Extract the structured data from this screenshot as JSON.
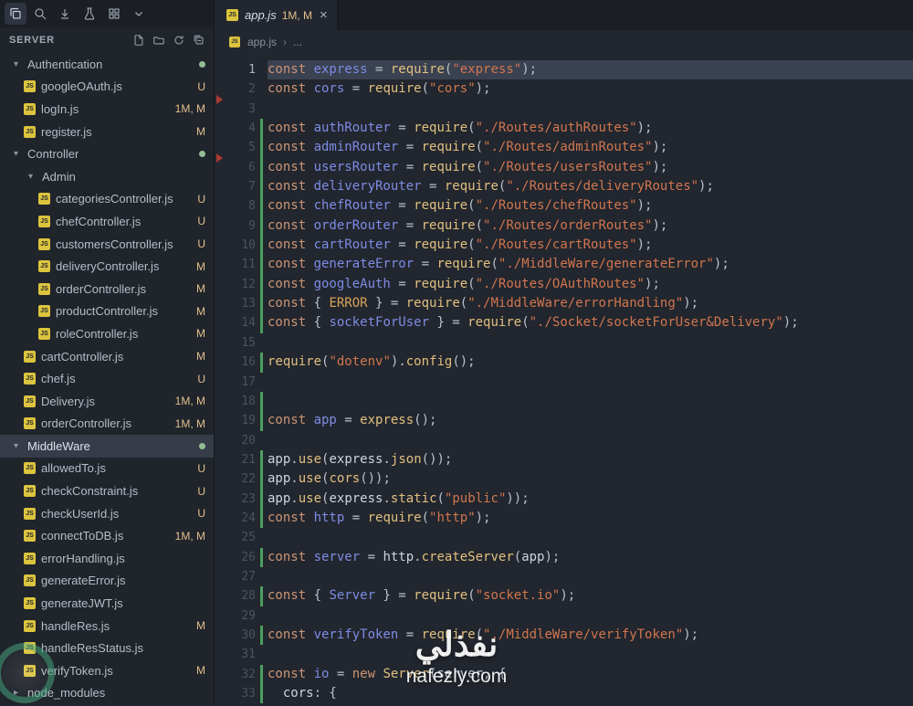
{
  "icons": {
    "js_label": "JS",
    "chevron_expanded": "▾",
    "chevron_collapsed": "▸",
    "breadcrumb_sep": "›",
    "more": "...",
    "close": "×"
  },
  "colors": {
    "editor_bg": "#22262e",
    "sidebar_bg": "#20242b",
    "topbar_bg": "#1b1e24",
    "selection_row": "#363d49",
    "line_highlight": "#3a4150",
    "git_add": "#4c9e5f",
    "git_delete": "#a83a31",
    "badge_modified": "#e2c08d",
    "folder_dot": "#93bd93",
    "js_icon": "#dcc43e"
  },
  "activity_bar": {
    "icons": [
      "copy-pages-icon",
      "search-icon",
      "download-icon",
      "beaker-icon",
      "grid-icon",
      "chevron-down-icon"
    ]
  },
  "sidebar": {
    "title": "SERVER",
    "actions": [
      "new-file-icon",
      "new-folder-icon",
      "refresh-icon",
      "collapse-all-icon"
    ],
    "tree": [
      {
        "type": "folder",
        "label": "Authentication",
        "depth": 0,
        "expanded": true,
        "dot": true
      },
      {
        "type": "file",
        "label": "googleOAuth.js",
        "depth": 1,
        "badge": "U"
      },
      {
        "type": "file",
        "label": "logIn.js",
        "depth": 1,
        "badge": "1M, M"
      },
      {
        "type": "file",
        "label": "register.js",
        "depth": 1,
        "badge": "M"
      },
      {
        "type": "folder",
        "label": "Controller",
        "depth": 0,
        "expanded": true,
        "dot": true
      },
      {
        "type": "folder",
        "label": "Admin",
        "depth": 1,
        "expanded": true
      },
      {
        "type": "file",
        "label": "categoriesController.js",
        "depth": 2,
        "badge": "U"
      },
      {
        "type": "file",
        "label": "chefController.js",
        "depth": 2,
        "badge": "U"
      },
      {
        "type": "file",
        "label": "customersController.js",
        "depth": 2,
        "badge": "U"
      },
      {
        "type": "file",
        "label": "deliveryController.js",
        "depth": 2,
        "badge": "M"
      },
      {
        "type": "file",
        "label": "orderController.js",
        "depth": 2,
        "badge": "M"
      },
      {
        "type": "file",
        "label": "productController.js",
        "depth": 2,
        "badge": "M"
      },
      {
        "type": "file",
        "label": "roleController.js",
        "depth": 2,
        "badge": "M"
      },
      {
        "type": "file",
        "label": "cartController.js",
        "depth": 1,
        "badge": "M"
      },
      {
        "type": "file",
        "label": "chef.js",
        "depth": 1,
        "badge": "U"
      },
      {
        "type": "file",
        "label": "Delivery.js",
        "depth": 1,
        "badge": "1M, M"
      },
      {
        "type": "file",
        "label": "orderController.js",
        "depth": 1,
        "badge": "1M, M"
      },
      {
        "type": "folder",
        "label": "MiddleWare",
        "depth": 0,
        "expanded": true,
        "dot": true,
        "selected": true
      },
      {
        "type": "file",
        "label": "allowedTo.js",
        "depth": 1,
        "badge": "U"
      },
      {
        "type": "file",
        "label": "checkConstraint.js",
        "depth": 1,
        "badge": "U"
      },
      {
        "type": "file",
        "label": "checkUserId.js",
        "depth": 1,
        "badge": "U"
      },
      {
        "type": "file",
        "label": "connectToDB.js",
        "depth": 1,
        "badge": "1M, M"
      },
      {
        "type": "file",
        "label": "errorHandling.js",
        "depth": 1
      },
      {
        "type": "file",
        "label": "generateError.js",
        "depth": 1
      },
      {
        "type": "file",
        "label": "generateJWT.js",
        "depth": 1
      },
      {
        "type": "file",
        "label": "handleRes.js",
        "depth": 1,
        "badge": "M"
      },
      {
        "type": "file",
        "label": "handleResStatus.js",
        "depth": 1
      },
      {
        "type": "file",
        "label": "verifyToken.js",
        "depth": 1,
        "badge": "M"
      },
      {
        "type": "folder",
        "label": "node_modules",
        "depth": 0,
        "expanded": false
      }
    ]
  },
  "editor": {
    "tab": {
      "label": "app.js",
      "status": "1M, M"
    },
    "breadcrumb": {
      "file": "app.js"
    },
    "code": {
      "lines": [
        {
          "n": 1,
          "hl": true,
          "tokens": [
            [
              "k",
              "const "
            ],
            [
              "i",
              "express "
            ],
            [
              "p",
              "= "
            ],
            [
              "f",
              "require"
            ],
            [
              "p",
              "("
            ],
            [
              "s",
              "\"express\""
            ],
            [
              "p",
              ");"
            ]
          ]
        },
        {
          "n": 2,
          "tokens": [
            [
              "k",
              "const "
            ],
            [
              "i",
              "cors "
            ],
            [
              "p",
              "= "
            ],
            [
              "f",
              "require"
            ],
            [
              "p",
              "("
            ],
            [
              "s",
              "\"cors\""
            ],
            [
              "p",
              ");"
            ]
          ]
        },
        {
          "n": 3,
          "del": true,
          "tokens": []
        },
        {
          "n": 4,
          "git": "add",
          "tokens": [
            [
              "k",
              "const "
            ],
            [
              "i",
              "authRouter "
            ],
            [
              "p",
              "= "
            ],
            [
              "f",
              "require"
            ],
            [
              "p",
              "("
            ],
            [
              "s",
              "\"./Routes/authRoutes\""
            ],
            [
              "p",
              ");"
            ]
          ]
        },
        {
          "n": 5,
          "git": "add",
          "tokens": [
            [
              "k",
              "const "
            ],
            [
              "i",
              "adminRouter "
            ],
            [
              "p",
              "= "
            ],
            [
              "f",
              "require"
            ],
            [
              "p",
              "("
            ],
            [
              "s",
              "\"./Routes/adminRoutes\""
            ],
            [
              "p",
              ");"
            ]
          ]
        },
        {
          "n": 6,
          "git": "add",
          "del": true,
          "tokens": [
            [
              "k",
              "const "
            ],
            [
              "i",
              "usersRouter "
            ],
            [
              "p",
              "= "
            ],
            [
              "f",
              "require"
            ],
            [
              "p",
              "("
            ],
            [
              "s",
              "\"./Routes/usersRoutes\""
            ],
            [
              "p",
              ");"
            ]
          ]
        },
        {
          "n": 7,
          "git": "add",
          "tokens": [
            [
              "k",
              "const "
            ],
            [
              "i",
              "deliveryRouter "
            ],
            [
              "p",
              "= "
            ],
            [
              "f",
              "require"
            ],
            [
              "p",
              "("
            ],
            [
              "s",
              "\"./Routes/deliveryRoutes\""
            ],
            [
              "p",
              ");"
            ]
          ]
        },
        {
          "n": 8,
          "git": "add",
          "tokens": [
            [
              "k",
              "const "
            ],
            [
              "i",
              "chefRouter "
            ],
            [
              "p",
              "= "
            ],
            [
              "f",
              "require"
            ],
            [
              "p",
              "("
            ],
            [
              "s",
              "\"./Routes/chefRoutes\""
            ],
            [
              "p",
              ");"
            ]
          ]
        },
        {
          "n": 9,
          "git": "add",
          "tokens": [
            [
              "k",
              "const "
            ],
            [
              "i",
              "orderRouter "
            ],
            [
              "p",
              "= "
            ],
            [
              "f",
              "require"
            ],
            [
              "p",
              "("
            ],
            [
              "s",
              "\"./Routes/orderRoutes\""
            ],
            [
              "p",
              ");"
            ]
          ]
        },
        {
          "n": 10,
          "git": "add",
          "tokens": [
            [
              "k",
              "const "
            ],
            [
              "i",
              "cartRouter "
            ],
            [
              "p",
              "= "
            ],
            [
              "f",
              "require"
            ],
            [
              "p",
              "("
            ],
            [
              "s",
              "\"./Routes/cartRoutes\""
            ],
            [
              "p",
              ");"
            ]
          ]
        },
        {
          "n": 11,
          "git": "add",
          "tokens": [
            [
              "k",
              "const "
            ],
            [
              "i",
              "generateError "
            ],
            [
              "p",
              "= "
            ],
            [
              "f",
              "require"
            ],
            [
              "p",
              "("
            ],
            [
              "s",
              "\"./MiddleWare/generateError\""
            ],
            [
              "p",
              ");"
            ]
          ]
        },
        {
          "n": 12,
          "git": "add",
          "tokens": [
            [
              "k",
              "const "
            ],
            [
              "i",
              "googleAuth "
            ],
            [
              "p",
              "= "
            ],
            [
              "f",
              "require"
            ],
            [
              "p",
              "("
            ],
            [
              "s",
              "\"./Routes/OAuthRoutes\""
            ],
            [
              "p",
              ");"
            ]
          ]
        },
        {
          "n": 13,
          "git": "add",
          "tokens": [
            [
              "k",
              "const "
            ],
            [
              "p",
              "{ "
            ],
            [
              "o",
              "ERROR"
            ],
            [
              "p",
              " } = "
            ],
            [
              "f",
              "require"
            ],
            [
              "p",
              "("
            ],
            [
              "s",
              "\"./MiddleWare/errorHandling\""
            ],
            [
              "p",
              ");"
            ]
          ]
        },
        {
          "n": 14,
          "git": "add",
          "tokens": [
            [
              "k",
              "const "
            ],
            [
              "p",
              "{ "
            ],
            [
              "i",
              "socketForUser"
            ],
            [
              "p",
              " } = "
            ],
            [
              "f",
              "require"
            ],
            [
              "p",
              "("
            ],
            [
              "s",
              "\"./Socket/socketForUser&Delivery\""
            ],
            [
              "p",
              ");"
            ]
          ]
        },
        {
          "n": 15,
          "tokens": []
        },
        {
          "n": 16,
          "git": "add",
          "tokens": [
            [
              "f",
              "require"
            ],
            [
              "p",
              "("
            ],
            [
              "s",
              "\"dotenv\""
            ],
            [
              "p",
              ")."
            ],
            [
              "f",
              "config"
            ],
            [
              "p",
              "();"
            ]
          ]
        },
        {
          "n": 17,
          "tokens": []
        },
        {
          "n": 18,
          "git": "add",
          "tokens": []
        },
        {
          "n": 19,
          "git": "add",
          "tokens": [
            [
              "k",
              "const "
            ],
            [
              "i",
              "app "
            ],
            [
              "p",
              "= "
            ],
            [
              "f",
              "express"
            ],
            [
              "p",
              "();"
            ]
          ]
        },
        {
          "n": 20,
          "tokens": []
        },
        {
          "n": 21,
          "git": "add",
          "tokens": [
            [
              "w",
              "app"
            ],
            [
              "p",
              "."
            ],
            [
              "f",
              "use"
            ],
            [
              "p",
              "("
            ],
            [
              "w",
              "express"
            ],
            [
              "p",
              "."
            ],
            [
              "f",
              "json"
            ],
            [
              "p",
              "());"
            ]
          ]
        },
        {
          "n": 22,
          "git": "add",
          "tokens": [
            [
              "w",
              "app"
            ],
            [
              "p",
              "."
            ],
            [
              "f",
              "use"
            ],
            [
              "p",
              "("
            ],
            [
              "f",
              "cors"
            ],
            [
              "p",
              "());"
            ]
          ]
        },
        {
          "n": 23,
          "git": "add",
          "tokens": [
            [
              "w",
              "app"
            ],
            [
              "p",
              "."
            ],
            [
              "f",
              "use"
            ],
            [
              "p",
              "("
            ],
            [
              "w",
              "express"
            ],
            [
              "p",
              "."
            ],
            [
              "f",
              "static"
            ],
            [
              "p",
              "("
            ],
            [
              "s",
              "\"public\""
            ],
            [
              "p",
              "));"
            ]
          ]
        },
        {
          "n": 24,
          "git": "add",
          "tokens": [
            [
              "k",
              "const "
            ],
            [
              "i",
              "http "
            ],
            [
              "p",
              "= "
            ],
            [
              "f",
              "require"
            ],
            [
              "p",
              "("
            ],
            [
              "s",
              "\"http\""
            ],
            [
              "p",
              ");"
            ]
          ]
        },
        {
          "n": 25,
          "tokens": []
        },
        {
          "n": 26,
          "git": "add",
          "tokens": [
            [
              "k",
              "const "
            ],
            [
              "i",
              "server "
            ],
            [
              "p",
              "= "
            ],
            [
              "w",
              "http"
            ],
            [
              "p",
              "."
            ],
            [
              "f",
              "createServer"
            ],
            [
              "p",
              "("
            ],
            [
              "w",
              "app"
            ],
            [
              "p",
              ");"
            ]
          ]
        },
        {
          "n": 27,
          "tokens": []
        },
        {
          "n": 28,
          "git": "add",
          "tokens": [
            [
              "k",
              "const "
            ],
            [
              "p",
              "{ "
            ],
            [
              "i",
              "Server"
            ],
            [
              "p",
              " } = "
            ],
            [
              "f",
              "require"
            ],
            [
              "p",
              "("
            ],
            [
              "s",
              "\"socket.io\""
            ],
            [
              "p",
              ");"
            ]
          ]
        },
        {
          "n": 29,
          "tokens": []
        },
        {
          "n": 30,
          "git": "add",
          "tokens": [
            [
              "k",
              "const "
            ],
            [
              "i",
              "verifyToken "
            ],
            [
              "p",
              "= "
            ],
            [
              "f",
              "require"
            ],
            [
              "p",
              "("
            ],
            [
              "s",
              "\"./MiddleWare/verifyToken\""
            ],
            [
              "p",
              ");"
            ]
          ]
        },
        {
          "n": 31,
          "tokens": []
        },
        {
          "n": 32,
          "git": "add",
          "tokens": [
            [
              "k",
              "const "
            ],
            [
              "i",
              "io "
            ],
            [
              "p",
              "= "
            ],
            [
              "k",
              "new "
            ],
            [
              "f",
              "Server"
            ],
            [
              "p",
              "("
            ],
            [
              "w",
              "server"
            ],
            [
              "p",
              ", {"
            ]
          ]
        },
        {
          "n": 33,
          "git": "add",
          "tokens": [
            [
              "p",
              "  "
            ],
            [
              "w",
              "cors"
            ],
            [
              "p",
              ": {"
            ]
          ]
        }
      ]
    }
  },
  "watermark": {
    "line1": "نفذلي",
    "line2": "nafezly.com"
  }
}
